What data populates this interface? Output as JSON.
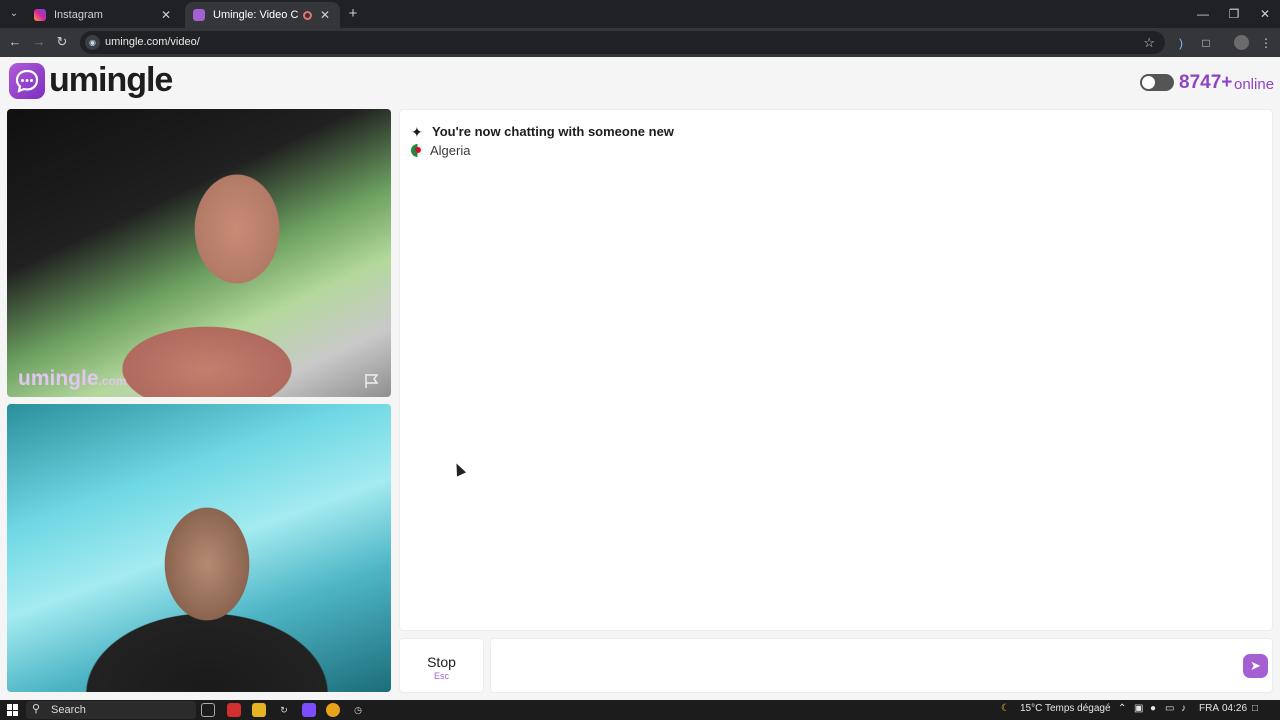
{
  "browser": {
    "tabs": [
      {
        "title": "Instagram",
        "icon": "instagram-icon"
      },
      {
        "title": "Umingle: Video Chat with St",
        "icon": "umingle-icon"
      }
    ],
    "url": "umingle.com/video/"
  },
  "header": {
    "logo_text": "umingle",
    "online_count": "8747+",
    "online_label": "online"
  },
  "video": {
    "watermark_main": "umingle",
    "watermark_suffix": ".com"
  },
  "chat": {
    "system_message": "You're now chatting with someone new",
    "country": "Algeria",
    "message_value": ""
  },
  "controls": {
    "stop_label": "Stop",
    "stop_key": "Esc"
  },
  "taskbar": {
    "search_label": "Search",
    "weather": "15°C  Temps dégagé",
    "language": "FRA",
    "time": "04:26"
  },
  "colors": {
    "brand": "#8e44c4",
    "send_button": "#a45fd3"
  }
}
